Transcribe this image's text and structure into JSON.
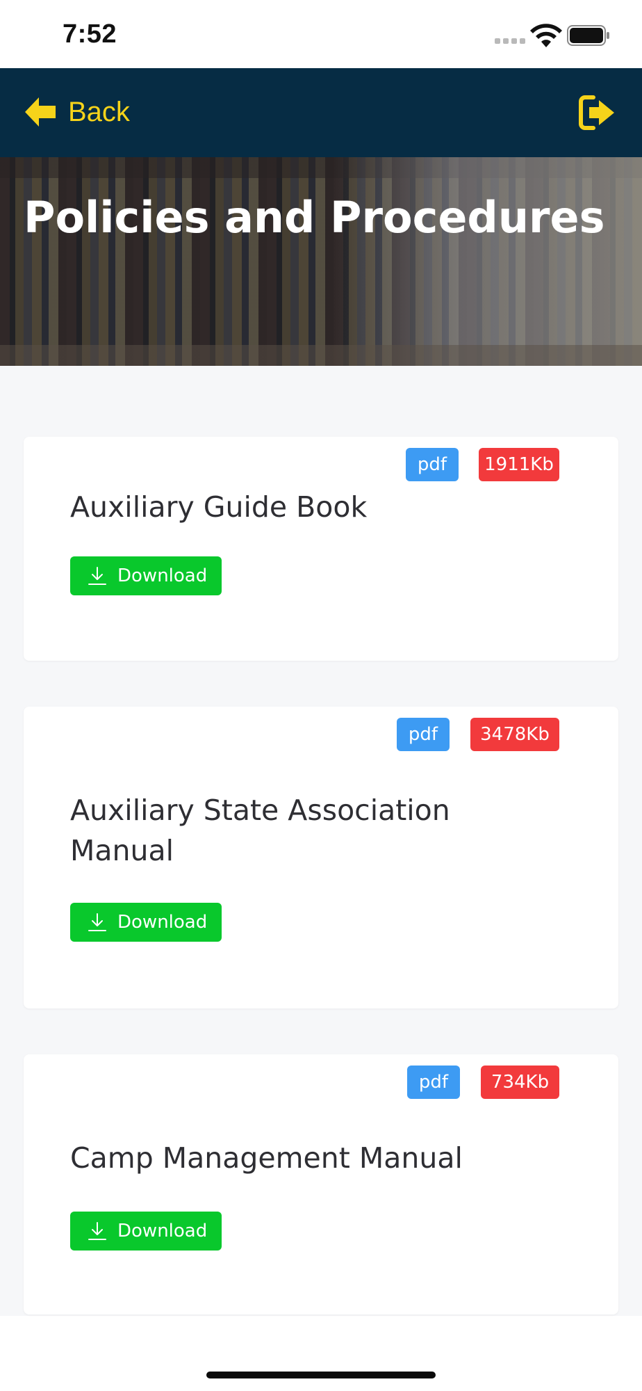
{
  "status_bar": {
    "time": "7:52"
  },
  "nav": {
    "back_label": "Back"
  },
  "hero": {
    "title": "Policies and Procedures"
  },
  "documents": [
    {
      "title": "Auxiliary Guide Book",
      "type": "pdf",
      "size": "1911Kb",
      "download_label": "Download"
    },
    {
      "title": "Auxiliary State Association Manual",
      "type": "pdf",
      "size": "3478Kb",
      "download_label": "Download"
    },
    {
      "title": "Camp Management Manual",
      "type": "pdf",
      "size": "734Kb",
      "download_label": "Download"
    }
  ],
  "colors": {
    "nav_background": "#062c44",
    "accent_yellow": "#f6d31a",
    "badge_type": "#3d9bf3",
    "badge_size": "#f23a3c",
    "download_green": "#09c82c"
  },
  "icons": {
    "back": "arrow-left-icon",
    "logout": "sign-out-icon",
    "download": "download-icon",
    "wifi": "wifi-icon",
    "battery": "battery-icon",
    "signal": "cellular-signal-icon"
  }
}
